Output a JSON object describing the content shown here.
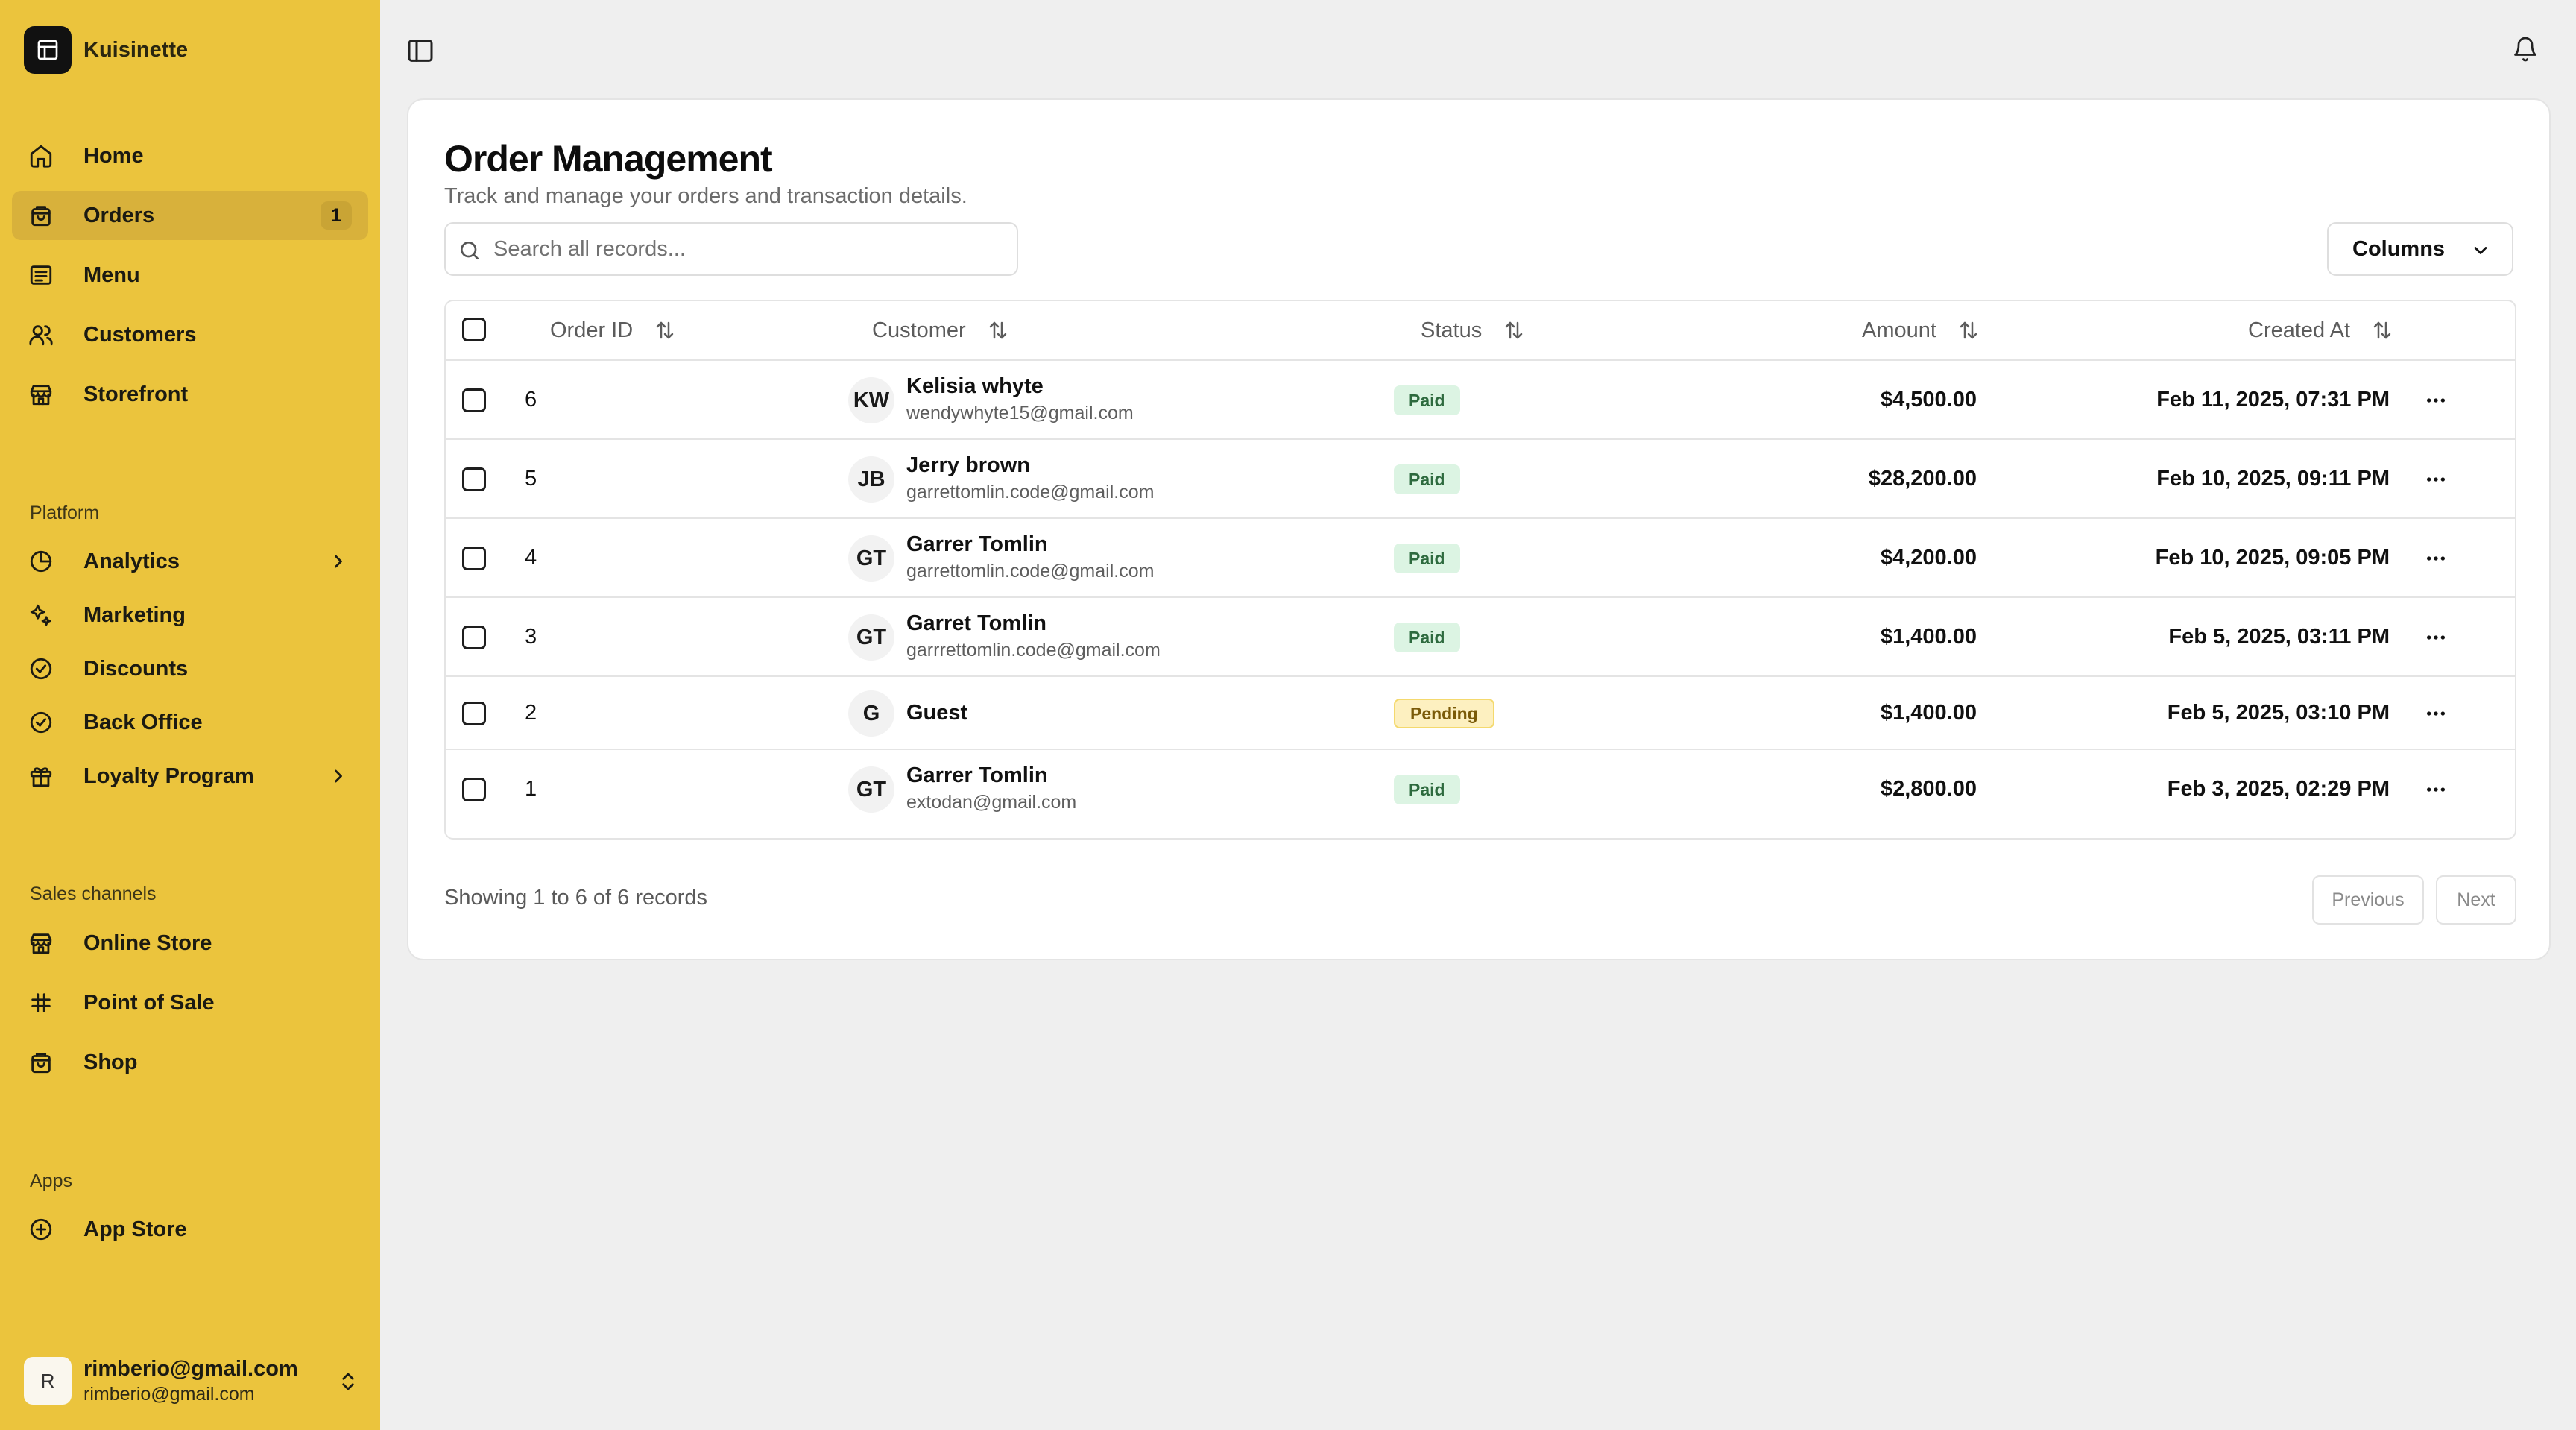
{
  "brand": {
    "name": "Kuisinette",
    "icon": "layout-icon"
  },
  "sidebar": {
    "main_items": [
      {
        "label": "Home",
        "icon": "home-icon"
      },
      {
        "label": "Orders",
        "icon": "shopping-bag-icon",
        "badge": "1",
        "active": true
      },
      {
        "label": "Menu",
        "icon": "menu-list-icon"
      },
      {
        "label": "Customers",
        "icon": "users-icon"
      },
      {
        "label": "Storefront",
        "icon": "store-icon"
      }
    ],
    "platform_label": "Platform",
    "platform_items": [
      {
        "label": "Analytics",
        "icon": "pie-chart-icon",
        "has_chevron": true
      },
      {
        "label": "Marketing",
        "icon": "sparkles-icon"
      },
      {
        "label": "Discounts",
        "icon": "badge-check-icon"
      },
      {
        "label": "Back Office",
        "icon": "badge-check-icon"
      },
      {
        "label": "Loyalty Program",
        "icon": "gift-icon",
        "has_chevron": true
      }
    ],
    "sales_label": "Sales channels",
    "sales_items": [
      {
        "label": "Online Store",
        "icon": "store-icon"
      },
      {
        "label": "Point of Sale",
        "icon": "hash-icon"
      },
      {
        "label": "Shop",
        "icon": "shopping-bag-icon"
      }
    ],
    "apps_label": "Apps",
    "apps_items": [
      {
        "label": "App Store",
        "icon": "plus-circle-icon"
      }
    ]
  },
  "user": {
    "initial": "R",
    "name": "rimberio@gmail.com",
    "email": "rimberio@gmail.com"
  },
  "main": {
    "title": "Order Management",
    "subtitle": "Track and manage your orders and transaction details.",
    "search_placeholder": "Search all records...",
    "columns_label": "Columns"
  },
  "table": {
    "headers": {
      "order_id": "Order ID",
      "customer": "Customer",
      "status": "Status",
      "amount": "Amount",
      "created_at": "Created At"
    },
    "rows": [
      {
        "id": "6",
        "initials": "KW",
        "name": "Kelisia whyte",
        "email": "wendywhyte15@gmail.com",
        "status": "Paid",
        "amount": "$4,500.00",
        "created": "Feb 11, 2025, 07:31 PM"
      },
      {
        "id": "5",
        "initials": "JB",
        "name": "Jerry brown",
        "email": "garrettomlin.code@gmail.com",
        "status": "Paid",
        "amount": "$28,200.00",
        "created": "Feb 10, 2025, 09:11 PM"
      },
      {
        "id": "4",
        "initials": "GT",
        "name": "Garrer Tomlin",
        "email": "garrettomlin.code@gmail.com",
        "status": "Paid",
        "amount": "$4,200.00",
        "created": "Feb 10, 2025, 09:05 PM"
      },
      {
        "id": "3",
        "initials": "GT",
        "name": "Garret Tomlin",
        "email": "garrrettomlin.code@gmail.com",
        "status": "Paid",
        "amount": "$1,400.00",
        "created": "Feb 5, 2025, 03:11 PM"
      },
      {
        "id": "2",
        "initials": "G",
        "name": "Guest",
        "email": "",
        "status": "Pending",
        "amount": "$1,400.00",
        "created": "Feb 5, 2025, 03:10 PM"
      },
      {
        "id": "1",
        "initials": "GT",
        "name": "Garrer Tomlin",
        "email": "extodan@gmail.com",
        "status": "Paid",
        "amount": "$2,800.00",
        "created": "Feb 3, 2025, 02:29 PM"
      }
    ]
  },
  "footer": {
    "showing": "Showing 1 to 6 of 6 records",
    "previous": "Previous",
    "next": "Next"
  },
  "colors": {
    "sidebar_bg": "#ebc43d",
    "active_item_bg": "#d8b13b",
    "paid_bg": "#dcf4e3",
    "pending_bg": "#fdf0c0"
  }
}
